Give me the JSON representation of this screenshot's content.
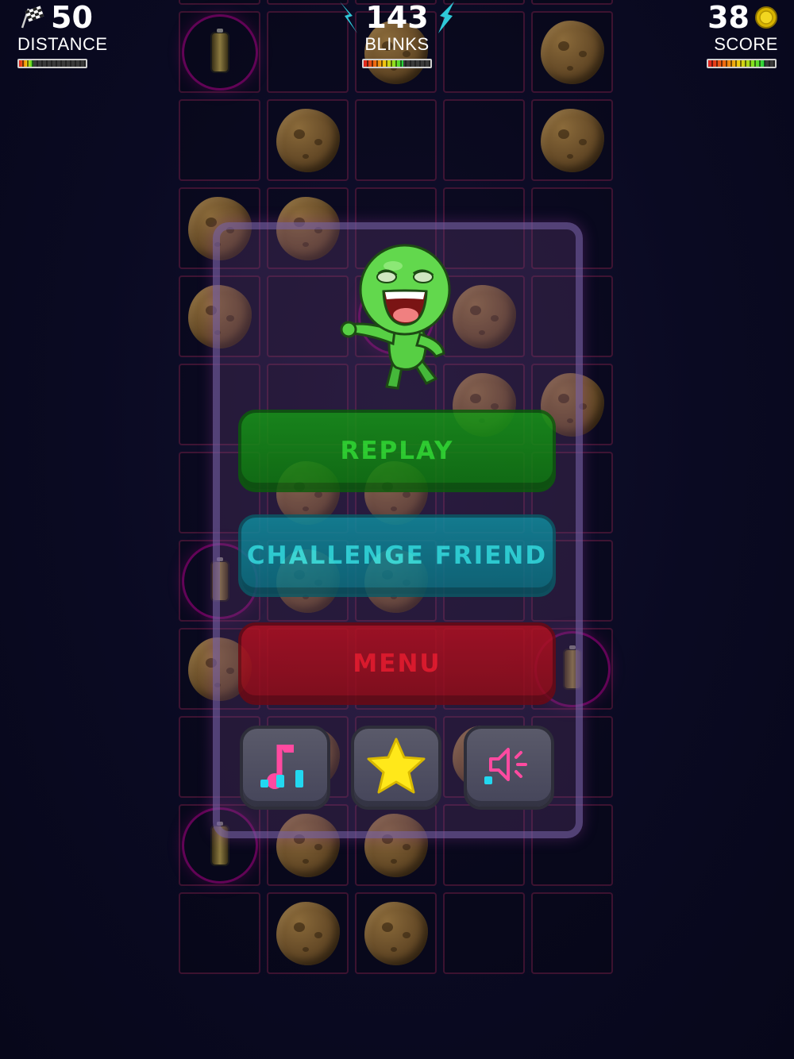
{
  "hud": {
    "distance": {
      "value": "50",
      "label": "DISTANCE",
      "meter_level": 0.22,
      "icon": "checkered-flag-icon"
    },
    "blinks": {
      "value": "143",
      "label": "BLINKS",
      "meter_level": 0.6,
      "icon": "lightning-bolt-icon"
    },
    "score": {
      "value": "38",
      "label": "SCORE",
      "meter_level": 0.85,
      "icon": "coin-icon"
    }
  },
  "menu": {
    "replay_label": "REPLAY",
    "challenge_label": "CHALLENGE FRIEND",
    "menu_label": "MENU",
    "icon_buttons": [
      "music-toggle-icon",
      "star-rate-icon",
      "sound-toggle-icon"
    ]
  },
  "colors": {
    "replay_text": "#2df02d",
    "challenge_text": "#2ff0f0",
    "menu_text": "#ff1a2a",
    "background": "#0a0a22"
  },
  "board": {
    "cols": 5,
    "rows": 12,
    "cells": [
      [
        "empty",
        "rock",
        "empty",
        "rock",
        "empty"
      ],
      [
        "battery",
        "empty",
        "rock",
        "empty",
        "rock"
      ],
      [
        "empty",
        "rock",
        "empty",
        "empty",
        "rock"
      ],
      [
        "rock",
        "rock",
        "empty",
        "empty",
        "empty"
      ],
      [
        "rock",
        "empty",
        "battery",
        "rock",
        "empty"
      ],
      [
        "empty",
        "empty",
        "empty",
        "rock",
        "rock"
      ],
      [
        "empty",
        "rock",
        "rock",
        "empty",
        "empty"
      ],
      [
        "battery",
        "rock",
        "rock",
        "empty",
        "empty"
      ],
      [
        "rock",
        "empty",
        "empty",
        "empty",
        "battery"
      ],
      [
        "empty",
        "rock",
        "empty",
        "rock",
        "empty"
      ],
      [
        "battery",
        "rock",
        "rock",
        "empty",
        "empty"
      ],
      [
        "empty",
        "rock",
        "rock",
        "empty",
        "empty"
      ]
    ]
  }
}
